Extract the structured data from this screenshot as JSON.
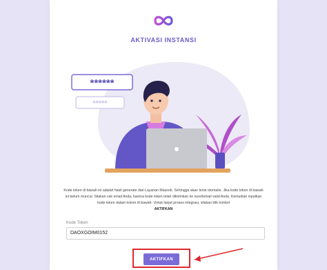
{
  "page": {
    "title": "AKTIVASI INSTANSI",
    "logo_icon": "infinity-icon"
  },
  "illustration": {
    "password_mask_top": "******",
    "password_mask_bottom": "*****"
  },
  "description": {
    "text": "Kode token di bawah ini adalah hasil generate dari Layanan Masook. Sehingga akan terisi otomatis. Jika kode token di bawah ini belum muncul. Silakan cek email Anda, karena kode token telah dikirimkan ke surel/email valid Anda. Kemudian inputkan kode token dalam kolom di bawah. Untuk lanjut proses integrasi, silakan klik tombol",
    "emphasis": "AKTIFKAN"
  },
  "form": {
    "token_label": "Kode Token",
    "token_value": "DAOXGOIM0152",
    "submit_label": "AKTIFKAN"
  },
  "colors": {
    "accent": "#7a6bd8",
    "title": "#6b5bc9",
    "highlight": "#e0262b"
  }
}
